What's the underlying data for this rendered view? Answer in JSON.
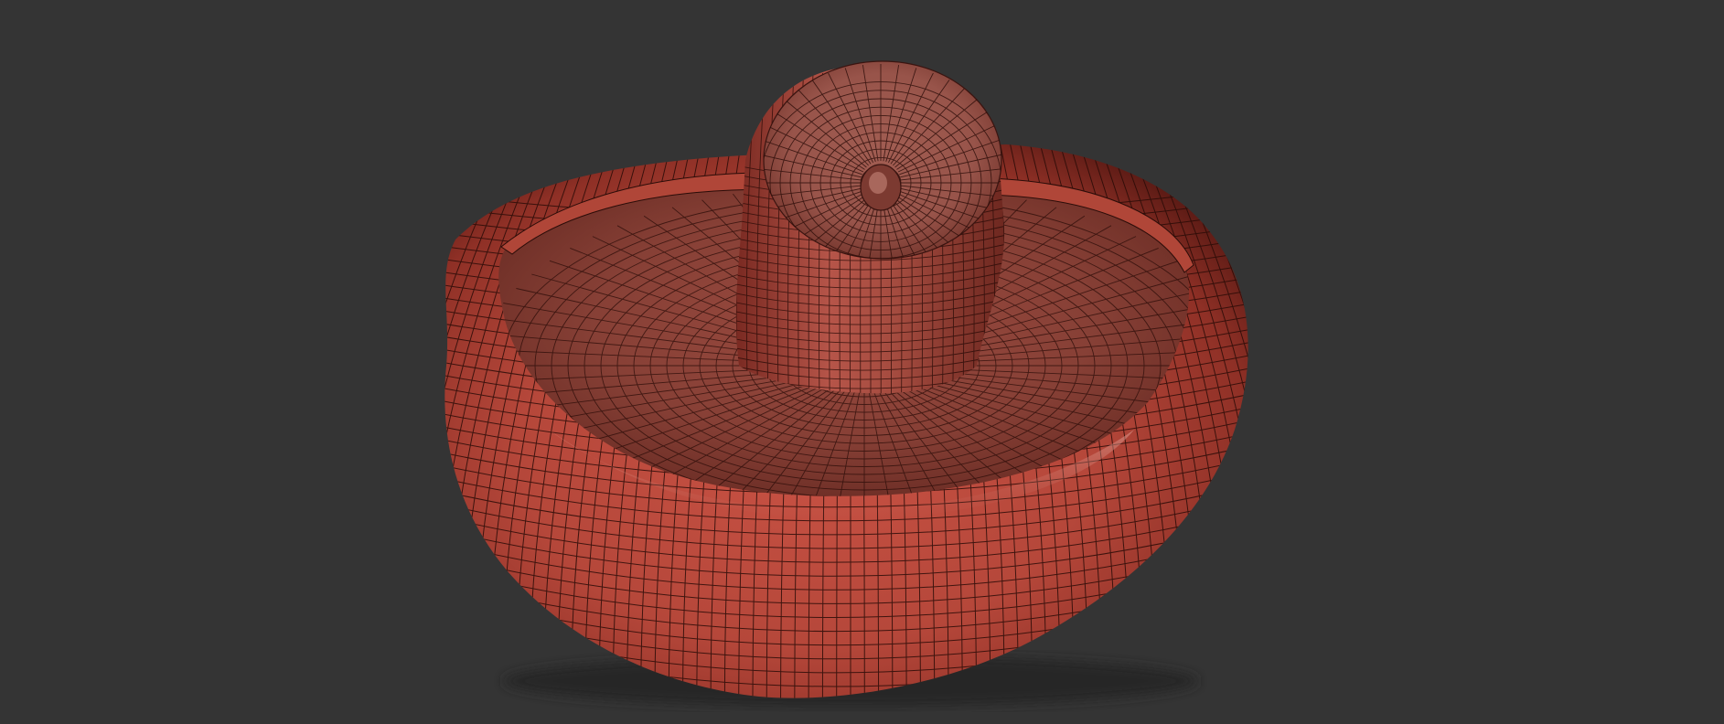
{
  "viewport": {
    "background_color": "#343434",
    "subject": "mushroom-mesh",
    "wireframe_visible": true
  },
  "model": {
    "base_color": "#b5473a",
    "highlight_color": "#d98a7d",
    "shadow_color": "#4a1410",
    "wire_color": "#2a0c08"
  }
}
